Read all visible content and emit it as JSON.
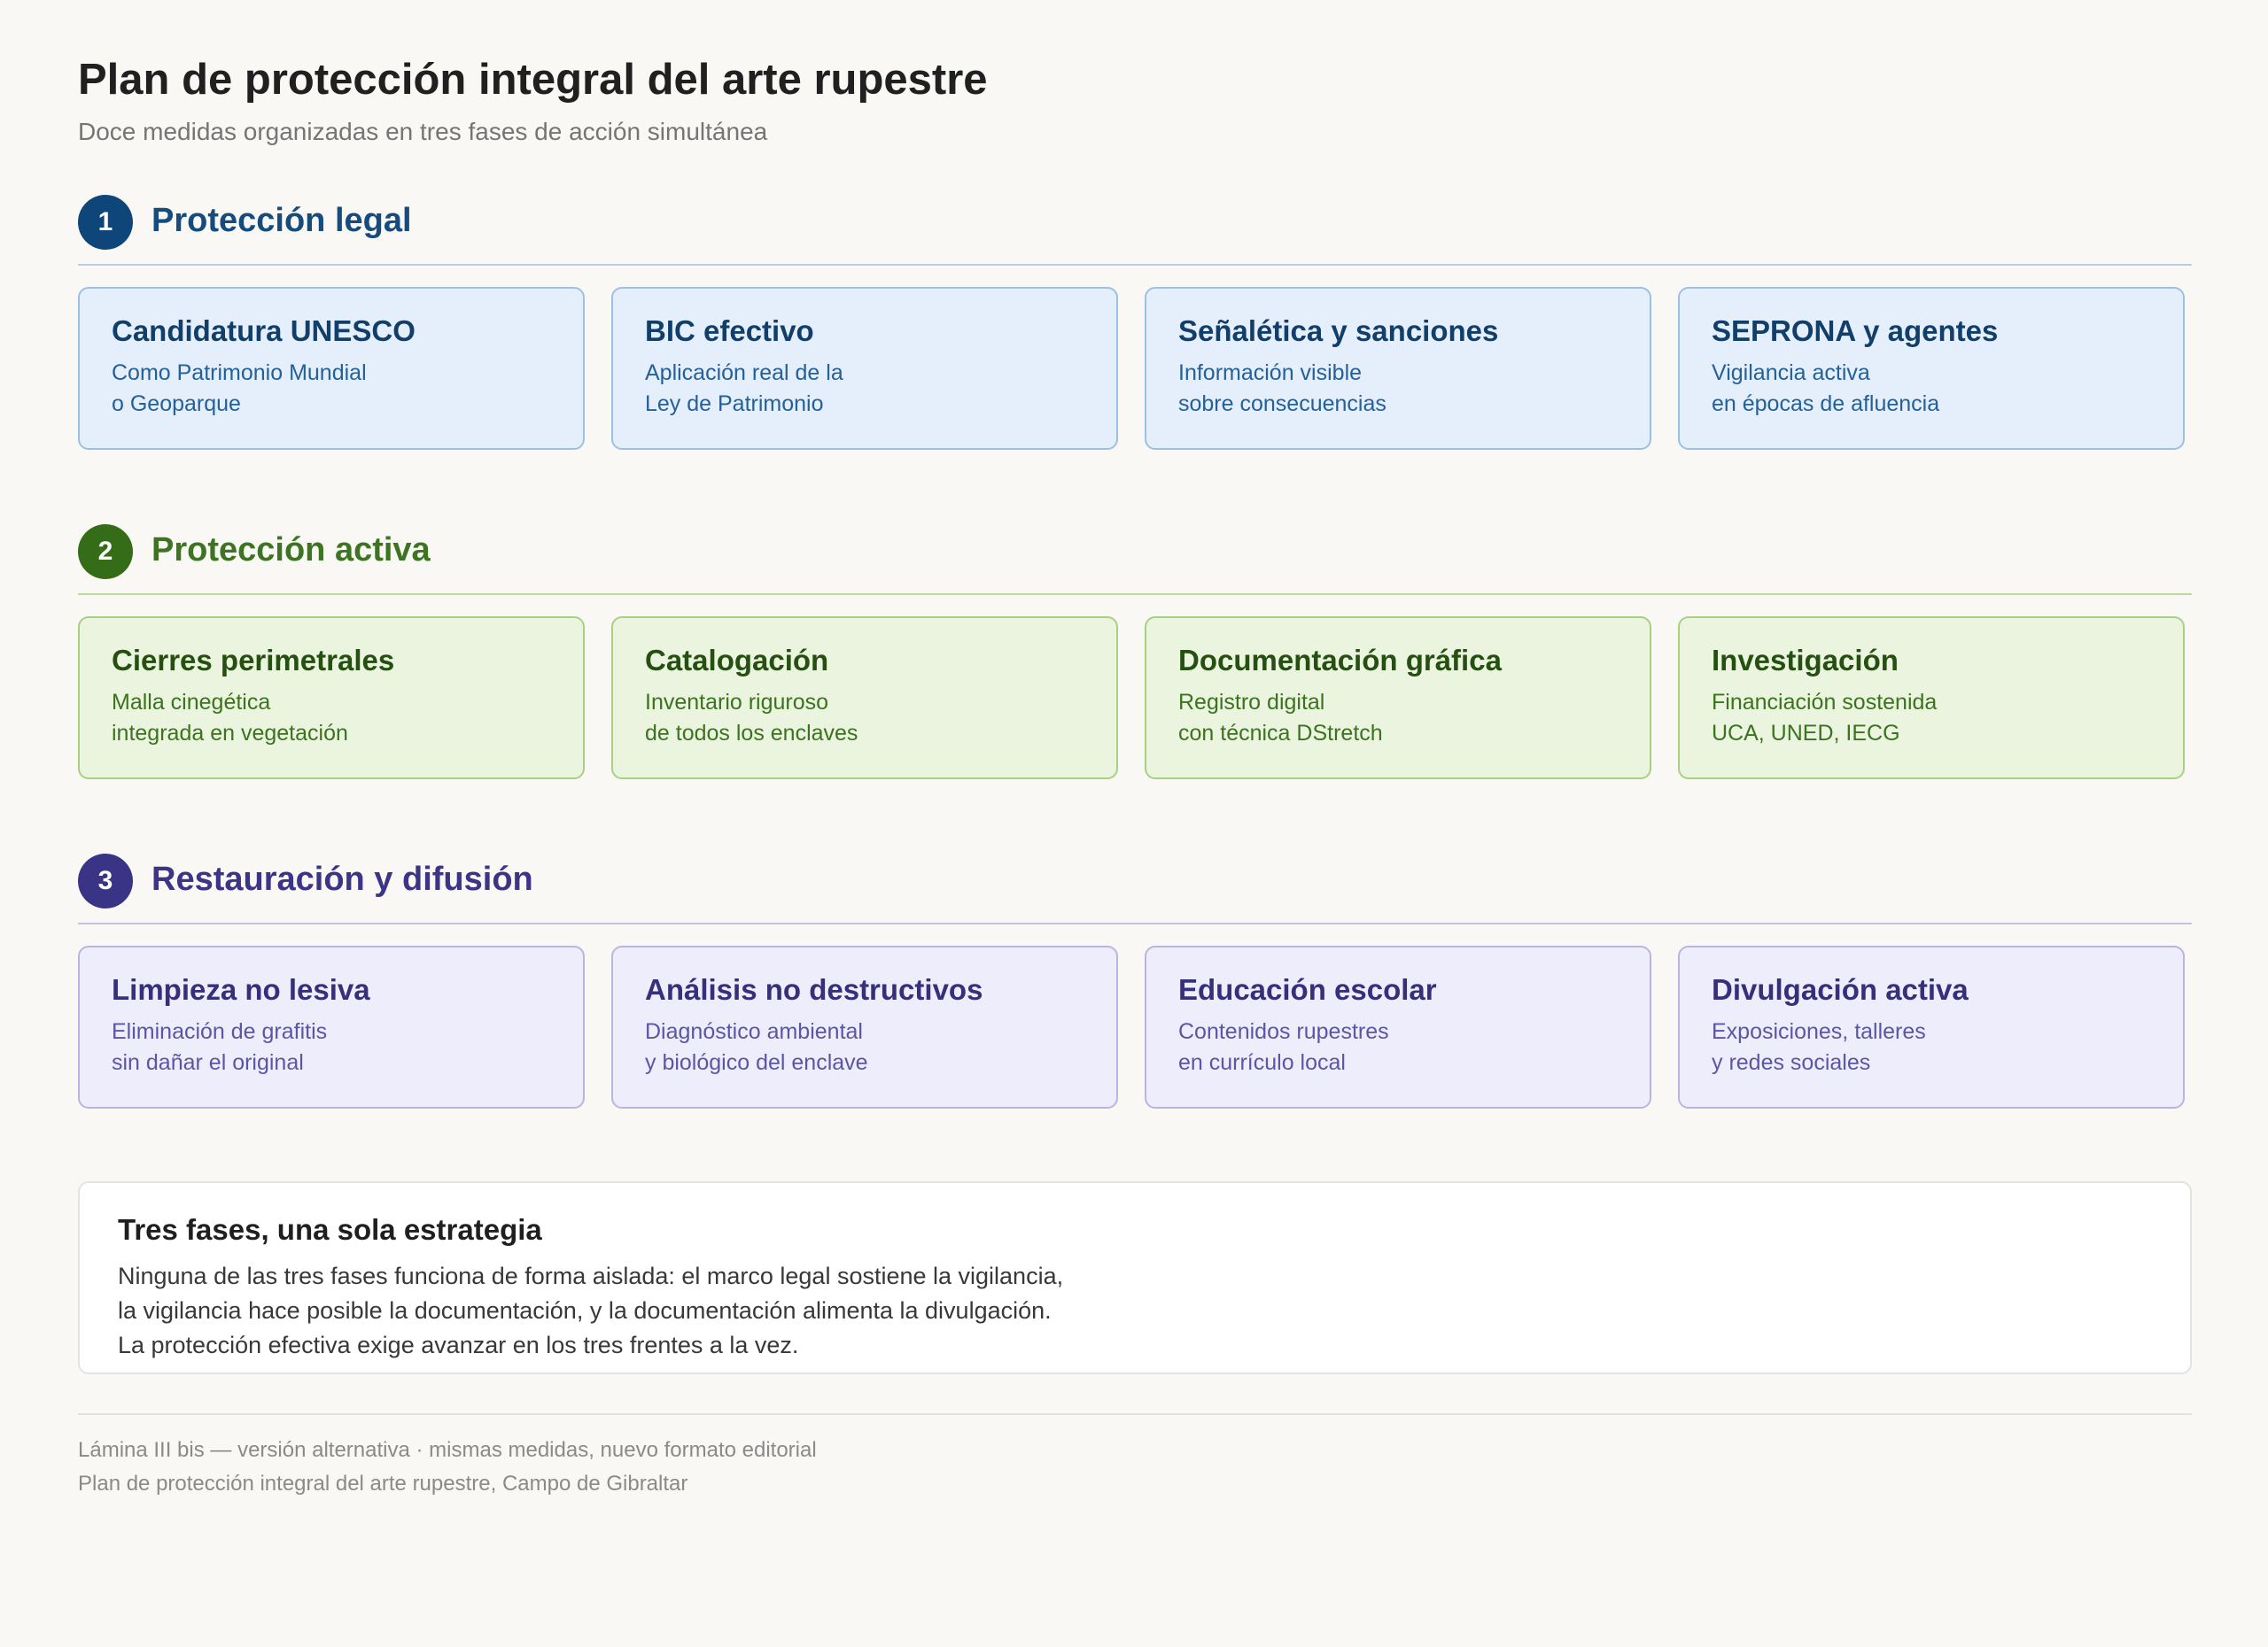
{
  "title": "Plan de protección integral del arte rupestre",
  "subtitle": "Doce medidas organizadas en tres fases de acción simultánea",
  "phases": [
    {
      "number": "1",
      "title": "Protección legal",
      "color": "#0f4679",
      "cards": [
        {
          "title": "Candidatura UNESCO",
          "line1": "Como Patrimonio Mundial",
          "line2": "o Geoparque"
        },
        {
          "title": "BIC efectivo",
          "line1": "Aplicación real de la",
          "line2": "Ley de Patrimonio"
        },
        {
          "title": "Señalética y sanciones",
          "line1": "Información visible",
          "line2": "sobre consecuencias"
        },
        {
          "title": "SEPRONA y agentes",
          "line1": "Vigilancia activa",
          "line2": "en épocas de afluencia"
        }
      ]
    },
    {
      "number": "2",
      "title": "Protección activa",
      "color": "#346c17",
      "cards": [
        {
          "title": "Cierres perimetrales",
          "line1": "Malla cinegética",
          "line2": "integrada en vegetación"
        },
        {
          "title": "Catalogación",
          "line1": "Inventario riguroso",
          "line2": "de todos los enclaves"
        },
        {
          "title": "Documentación gráfica",
          "line1": "Registro digital",
          "line2": "con técnica DStretch"
        },
        {
          "title": "Investigación",
          "line1": "Financiación sostenida",
          "line2": "UCA, UNED, IECG"
        }
      ]
    },
    {
      "number": "3",
      "title": "Restauración y difusión",
      "color": "#3a3487",
      "cards": [
        {
          "title": "Limpieza no lesiva",
          "line1": "Eliminación de grafitis",
          "line2": "sin dañar el original"
        },
        {
          "title": "Análisis no destructivos",
          "line1": "Diagnóstico ambiental",
          "line2": "y biológico del enclave"
        },
        {
          "title": "Educación escolar",
          "line1": "Contenidos rupestres",
          "line2": "en currículo local"
        },
        {
          "title": "Divulgación activa",
          "line1": "Exposiciones, talleres",
          "line2": "y redes sociales"
        }
      ]
    }
  ],
  "summary": {
    "title": "Tres fases, una sola estrategia",
    "line1": "Ninguna de las tres fases funciona de forma aislada: el marco legal sostiene la vigilancia,",
    "line2": "la vigilancia hace posible la documentación, y la documentación alimenta la divulgación.",
    "line3": "La protección efectiva exige avanzar en los tres frentes a la vez."
  },
  "footer": {
    "line1": "Lámina III bis — versión alternativa · mismas medidas, nuevo formato editorial",
    "line2": "Plan de protección integral del arte rupestre, Campo de Gibraltar"
  }
}
